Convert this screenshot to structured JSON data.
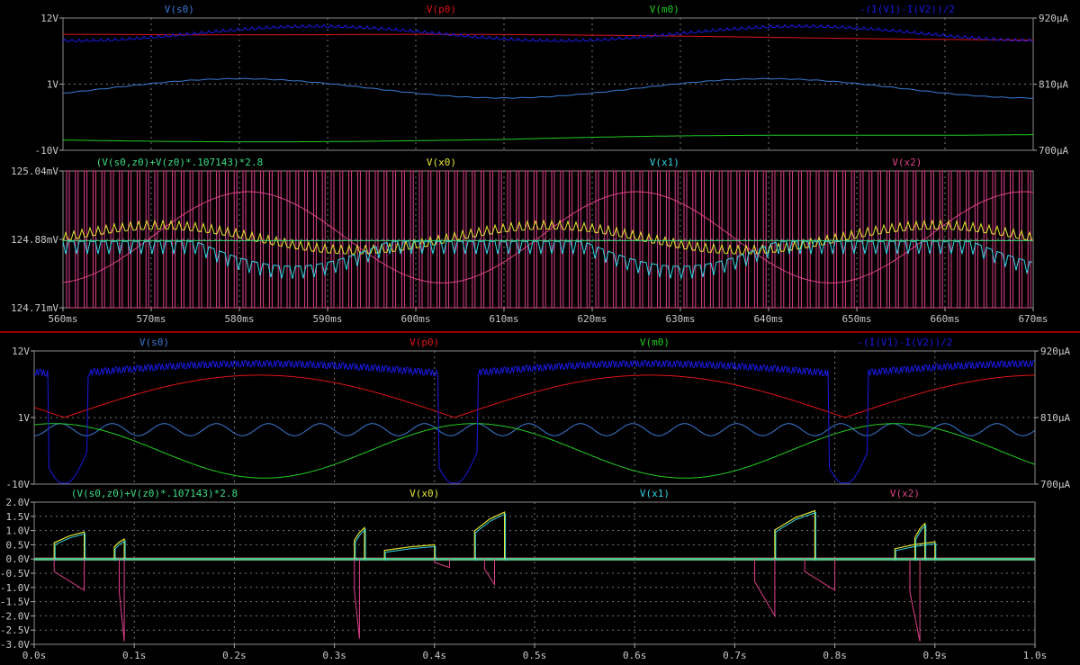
{
  "window": {
    "divider_color": "#cc0000"
  },
  "panes": [
    {
      "id": "top-voltages",
      "y_left_ticks": [
        "12V",
        "1V",
        "-10V"
      ],
      "y_right_ticks": [
        "920µA",
        "810µA",
        "700µA"
      ],
      "traces": [
        {
          "name": "V(s0)",
          "color": "#3a7bd5"
        },
        {
          "name": "V(p0)",
          "color": "#e01414"
        },
        {
          "name": "V(m0)",
          "color": "#22cc22"
        },
        {
          "name": "-(I(V1)-I(V2))/2",
          "color": "#1a1ae6"
        }
      ]
    },
    {
      "id": "top-fine",
      "y_left_ticks": [
        "125.04mV",
        "124.88mV",
        "124.71mV"
      ],
      "traces": [
        {
          "name": "(V(s0,z0)+V(z0)*.107143)*2.8",
          "color": "#3ddc84"
        },
        {
          "name": "V(x0)",
          "color": "#e6e633"
        },
        {
          "name": "V(x1)",
          "color": "#33d6e6"
        },
        {
          "name": "V(x2)",
          "color": "#e0408a"
        }
      ],
      "x_ticks": [
        "560ms",
        "570ms",
        "580ms",
        "590ms",
        "600ms",
        "610ms",
        "620ms",
        "630ms",
        "640ms",
        "650ms",
        "660ms",
        "670ms"
      ]
    },
    {
      "id": "bottom-voltages",
      "y_left_ticks": [
        "12V",
        "1V",
        "-10V"
      ],
      "y_right_ticks": [
        "920µA",
        "810µA",
        "700µA"
      ],
      "traces": [
        {
          "name": "V(s0)",
          "color": "#3a7bd5"
        },
        {
          "name": "V(p0)",
          "color": "#e01414"
        },
        {
          "name": "V(m0)",
          "color": "#22cc22"
        },
        {
          "name": "-(I(V1)-I(V2))/2",
          "color": "#1a1ae6"
        }
      ]
    },
    {
      "id": "bottom-fine",
      "y_left_ticks": [
        "2.0V",
        "1.5V",
        "1.0V",
        "0.5V",
        "0.0V",
        "-0.5V",
        "-1.0V",
        "-1.5V",
        "-2.0V",
        "-2.5V",
        "-3.0V"
      ],
      "traces": [
        {
          "name": "(V(s0,z0)+V(z0)*.107143)*2.8",
          "color": "#3ddc84"
        },
        {
          "name": "V(x0)",
          "color": "#e6e633"
        },
        {
          "name": "V(x1)",
          "color": "#33d6e6"
        },
        {
          "name": "V(x2)",
          "color": "#e0408a"
        }
      ],
      "x_ticks": [
        "0.0s",
        "0.1s",
        "0.2s",
        "0.3s",
        "0.4s",
        "0.5s",
        "0.6s",
        "0.7s",
        "0.8s",
        "0.9s",
        "1.0s"
      ]
    }
  ],
  "chart_data": [
    {
      "type": "line",
      "title": "",
      "x": {
        "range": [
          560,
          670
        ],
        "unit": "ms"
      },
      "y_left": {
        "range": [
          -10,
          12
        ],
        "unit": "V"
      },
      "y_right": {
        "range": [
          700,
          920
        ],
        "unit": "µA"
      },
      "grid": true,
      "series": [
        {
          "name": "V(s0)",
          "approx": "sine ~1.3V mean, amplitude ~1.6V, period ~60ms"
        },
        {
          "name": "V(p0)",
          "approx": "slow decline from ~9.3V to ~8.2V"
        },
        {
          "name": "V(m0)",
          "approx": "near -8.5V, slowly rising to ~-7V"
        },
        {
          "name": "-(I(V1)-I(V2))/2",
          "approx": "~890µA with ripple, peak ~910µA near 600ms and 640ms"
        }
      ]
    },
    {
      "type": "line",
      "title": "",
      "x": {
        "range": [
          560,
          670
        ],
        "unit": "ms"
      },
      "y": {
        "range": [
          124.71,
          125.04
        ],
        "unit": "mV"
      },
      "grid": true,
      "series": [
        {
          "name": "(V(s0,z0)+V(z0)*.107143)*2.8",
          "approx": "flat ~124.87mV"
        },
        {
          "name": "V(x0)",
          "approx": "switching between ~124.95mV and ~124.84mV"
        },
        {
          "name": "V(x1)",
          "approx": "switching, dips to ~124.74mV"
        },
        {
          "name": "V(x2)",
          "approx": "square-wave switching full span 124.71-125.04mV, envelope arches"
        }
      ]
    },
    {
      "type": "line",
      "title": "",
      "x": {
        "range": [
          0,
          1.0
        ],
        "unit": "s"
      },
      "y_left": {
        "range": [
          -10,
          12
        ],
        "unit": "V"
      },
      "y_right": {
        "range": [
          700,
          920
        ],
        "unit": "µA"
      },
      "grid": true,
      "series": [
        {
          "name": "V(s0)",
          "approx": "sine ~1V amplitude, period ~0.05s, mean ~-1V"
        },
        {
          "name": "V(p0)",
          "approx": "half-wave arches 1V..8V, zeros near 0.03s, 0.41s, 0.82s"
        },
        {
          "name": "V(m0)",
          "approx": "sinusoid mean ~-4.5V, amplitude ~4.5V, period ~0.42s"
        },
        {
          "name": "-(I(V1)-I(V2))/2",
          "approx": "~890µA with ripple, dips to ~700µA near 0.0s, 0.4s, 0.8s"
        }
      ]
    },
    {
      "type": "line",
      "title": "",
      "x": {
        "range": [
          0,
          1.0
        ],
        "unit": "s"
      },
      "y": {
        "range": [
          -3.0,
          2.0
        ],
        "unit": "V"
      },
      "grid": true,
      "series": [
        {
          "name": "(V(s0,z0)+V(z0)*.107143)*2.8",
          "approx": "flat 0V with switching band"
        },
        {
          "name": "V(x0)",
          "approx": "bursts up to ~1.7V near 0.05, 0.33, 0.46, 0.74, 0.88s"
        },
        {
          "name": "V(x1)",
          "approx": "bursts up to ~1.5V matching V(x0)"
        },
        {
          "name": "V(x2)",
          "approx": "bursts down to ~-2.9V near 0.09, 0.32, 0.72, 0.88s"
        }
      ]
    }
  ]
}
